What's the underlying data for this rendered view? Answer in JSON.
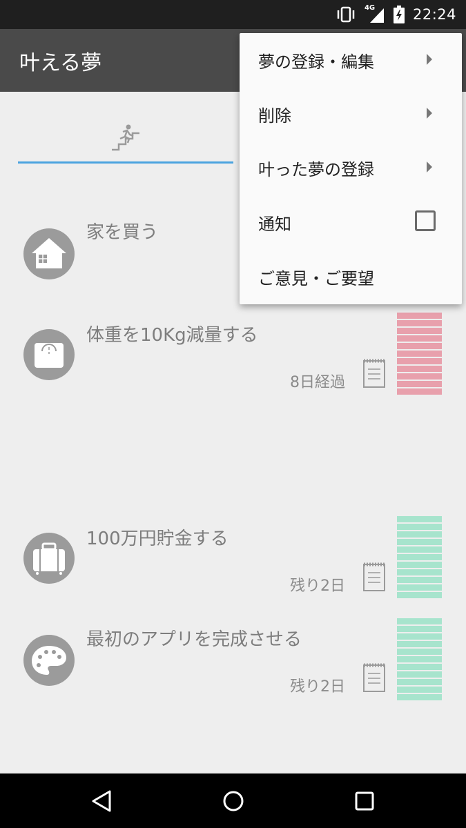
{
  "status_bar": {
    "network": "4G",
    "time": "22:24"
  },
  "app_bar": {
    "title": "叶える夢"
  },
  "tabs": [
    {
      "icon": "running-stairs-icon",
      "selected": true
    }
  ],
  "dreams": [
    {
      "title": "家を買う",
      "meta": "",
      "icon": "house-icon",
      "progress_color": "#e8a0ac"
    },
    {
      "title": "体重を10Kg減量する",
      "meta": "8日経過",
      "icon": "scale-icon",
      "progress_color": "#e8a0ac"
    },
    {
      "title": "100万円貯金する",
      "meta": "残り2日",
      "icon": "suitcase-icon",
      "progress_color": "#a7e4cd"
    },
    {
      "title": "最初のアプリを完成させる",
      "meta": "残り2日",
      "icon": "palette-icon",
      "progress_color": "#a7e4cd"
    }
  ],
  "menu": {
    "items": [
      {
        "label": "夢の登録・編集",
        "type": "submenu"
      },
      {
        "label": "削除",
        "type": "submenu"
      },
      {
        "label": "叶った夢の登録",
        "type": "submenu"
      },
      {
        "label": "通知",
        "type": "checkbox",
        "checked": false
      },
      {
        "label": "ご意見・ご要望",
        "type": "action"
      }
    ]
  },
  "colors": {
    "app_bar": "#4a4a4a",
    "status_bar": "#1f1f1f",
    "tab_indicator": "#4aa3df",
    "pink_stack": "#e8a0ac",
    "green_stack": "#a7e4cd"
  }
}
